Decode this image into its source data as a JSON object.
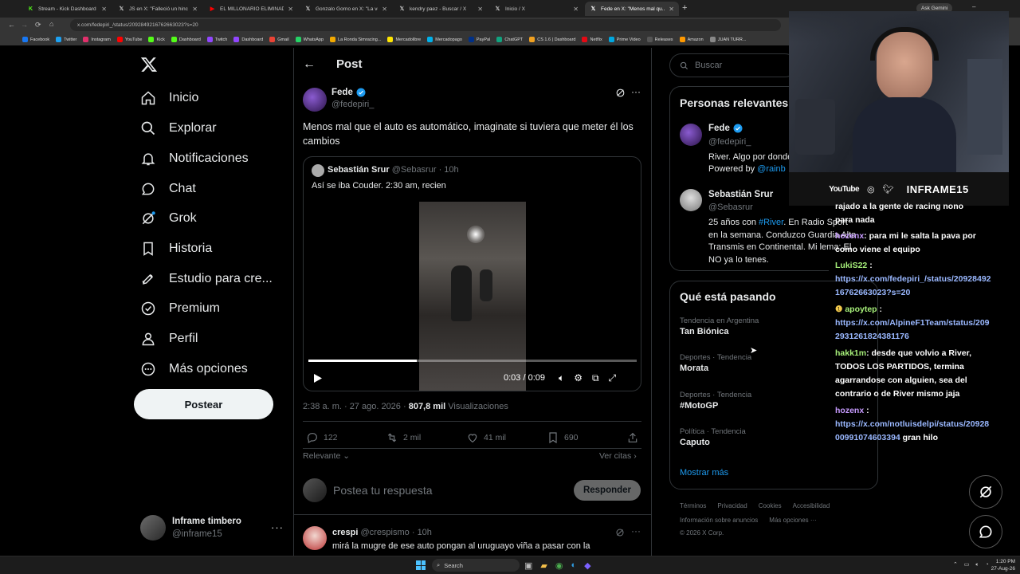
{
  "browser": {
    "tabs": [
      {
        "label": "Stream - Kick Dashboard",
        "icon": "kick-icon",
        "color": "#53fc18"
      },
      {
        "label": "JS en X: \"Falleció un hincha...",
        "icon": "x-icon",
        "color": "#ffffff"
      },
      {
        "label": "EL MILLONARIO ELIMINADO E...",
        "icon": "youtube-icon",
        "color": "#ff0000"
      },
      {
        "label": "Gonzalo Gorno en X: \"La venia...",
        "icon": "x-icon",
        "color": "#ffffff"
      },
      {
        "label": "kendry paez - Buscar / X",
        "icon": "x-icon",
        "color": "#ffffff"
      },
      {
        "label": "Inicio / X",
        "icon": "x-icon",
        "color": "#ffffff"
      },
      {
        "label": "Fede en X: \"Menos mal qu...",
        "icon": "x-icon",
        "color": "#ffffff"
      }
    ],
    "url": "x.com/fedepiri_/status/2092849216762663023?s=20",
    "ask_gemini": "Ask Gemini",
    "bookmarks": [
      "Facebook",
      "Twitter",
      "Instagram",
      "YouTube",
      "Kick",
      "Dashboard",
      "Twitch",
      "Dashboard",
      "Gmail",
      "WhatsApp",
      "La Ronda Simracing...",
      "Mercadolibre",
      "Mercadopago",
      "PayPal",
      "ChatGPT",
      "CS 1.6 | Dashboard",
      "Netflix",
      "Prime Video",
      "Releases",
      "Amazon",
      "JUAN TURR..."
    ]
  },
  "nav": {
    "items": [
      {
        "label": "Inicio",
        "icon": "home-icon"
      },
      {
        "label": "Explorar",
        "icon": "search-icon"
      },
      {
        "label": "Notificaciones",
        "icon": "bell-icon"
      },
      {
        "label": "Chat",
        "icon": "chat-icon"
      },
      {
        "label": "Grok",
        "icon": "grok-icon"
      },
      {
        "label": "Historia",
        "icon": "bookmark-icon"
      },
      {
        "label": "Estudio para cre...",
        "icon": "rocket-icon"
      },
      {
        "label": "Premium",
        "icon": "verified-icon"
      },
      {
        "label": "Perfil",
        "icon": "person-icon"
      },
      {
        "label": "Más opciones",
        "icon": "more-circle-icon"
      }
    ],
    "post_button": "Postear",
    "account": {
      "name": "Inframe timbero",
      "handle": "@inframe15"
    }
  },
  "post": {
    "header_title": "Post",
    "author_name": "Fede",
    "author_handle": "@fedepiri_",
    "text": "Menos mal que el auto es automático, imaginate si tuviera que meter él los cambios",
    "quote": {
      "name": "Sebastián Srur",
      "handle": "@Sebasrur",
      "time": "· 10h",
      "text": "Así se iba Couder. 2:30 am, recien",
      "video_time": "0:03 / 0:09",
      "progress": 0.33
    },
    "meta_time": "2:38 a. m. · 27 ago. 2026 ·",
    "views_count": "807,8 mil",
    "views_label": "Visualizaciones",
    "stats": {
      "replies": "122",
      "reposts": "2 mil",
      "likes": "41 mil",
      "bookmarks": "690"
    },
    "sort_label": "Relevante",
    "quotes_link": "Ver citas",
    "reply_placeholder": "Postea tu respuesta",
    "reply_button": "Responder",
    "reply": {
      "name": "crespi",
      "handle": "@crespismo",
      "time": "· 10h",
      "text": "mirá la mugre de ese auto pongan al uruguayo viña a pasar con la"
    }
  },
  "right": {
    "search_placeholder": "Buscar",
    "people_title": "Personas relevantes",
    "people": [
      {
        "name": "Fede",
        "handle": "@fedepiri_",
        "bio_1": "River. Algo por donde",
        "bio_2_prefix": "Powered by ",
        "bio_2_link": "@rainb"
      },
      {
        "name": "Sebastián Srur",
        "handle": "@Sebasrur",
        "bio_1_prefix": "25 años con ",
        "bio_1_link": "#River",
        "bio_1_suffix": ". En Radio Sport",
        "bio_2": "en la semana. Conduzco Guardia Alta",
        "bio_3": "Transmis en Continental. Mi lema: El",
        "bio_4": "NO ya lo tenes."
      }
    ],
    "trends_title": "Qué está pasando",
    "trends": [
      {
        "context": "Tendencia en Argentina",
        "name": "Tan Biónica"
      },
      {
        "context": "Deportes · Tendencia",
        "name": "Morata"
      },
      {
        "context": "Deportes · Tendencia",
        "name": "#MotoGP"
      },
      {
        "context": "Política · Tendencia",
        "name": "Caputo"
      }
    ],
    "show_more": "Mostrar más",
    "footer_1": [
      "Términos",
      "Privacidad",
      "Cookies",
      "Accesibilidad"
    ],
    "footer_2": [
      "Información sobre anuncios",
      "Más opciones ···"
    ],
    "copyright": "© 2026 X Corp."
  },
  "stream": {
    "social": [
      "YouTube",
      "INFRAME15"
    ],
    "chat": [
      {
        "user": "",
        "text": "t​rata lo de la gente de racing nono para nada",
        "l1": "rajado a la gente de racing nono",
        "l2": "para nada"
      },
      {
        "user": "hozenx",
        "text": ": para mi le salta la pava por",
        "cont": "como viene el equipo"
      },
      {
        "user": "LukiS22",
        "text": " :",
        "link1": "https://x.com/fedepiri_/status/20928492",
        "link2": "16762663023?s=20"
      },
      {
        "user": "apoytep",
        "text": " :",
        "link1": "https://x.com/AlpineF1Team/status/209",
        "link2": "2931261824381176"
      },
      {
        "user": "hakk1m",
        "text": ": desde que volvio a River,",
        "cont1": "TODOS LOS PARTIDOS, termina",
        "cont2": "agarrandose con alguien, sea del",
        "cont3": "contrario o de River mismo jaja"
      },
      {
        "user": "hozenx",
        "text": " :",
        "link1": "https://x.com/notluisdelpi/status/20928",
        "link2": "00991074603394",
        "tail": " gran hilo"
      }
    ]
  },
  "taskbar": {
    "search": "Search",
    "time": "1:20 PM",
    "date": "27-Aug-26"
  },
  "colors": {
    "accent": "#1d9bf0",
    "background": "#000000",
    "border": "#2f3336",
    "chat_user": "#a7f07a"
  }
}
